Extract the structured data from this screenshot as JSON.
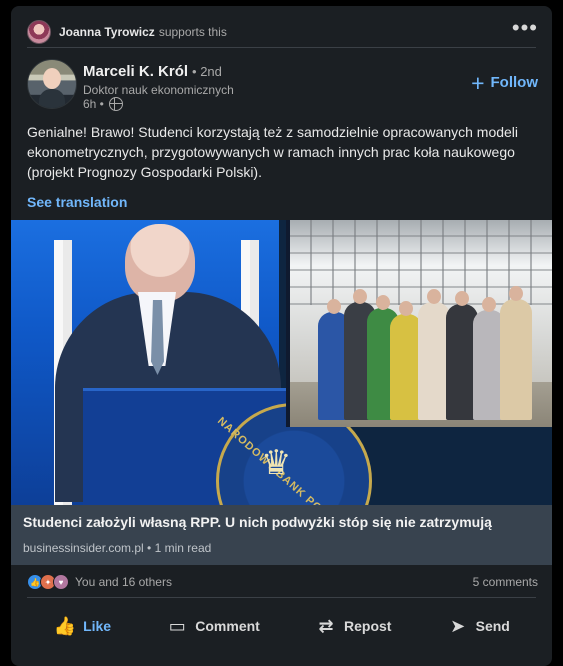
{
  "social": {
    "name": "Joanna Tyrowicz",
    "action": "supports this",
    "more_icon": "more-icon"
  },
  "author": {
    "name": "Marceli K. Król",
    "degree": "• 2nd",
    "headline": "Doktor nauk ekonomicznych",
    "time": "6h •",
    "visibility_icon": "globe-icon",
    "follow": "Follow"
  },
  "post": {
    "text": "Genialne! Brawo! Studenci korzystają też z samodzielnie opracowanych modeli ekonometrycznych, przygotowywanych w ramach innych prac koła naukowego (projekt Prognozy Gospodarki Polski).",
    "translate": "See translation"
  },
  "media": {
    "title": "Studenci założyli własną RPP. U nich podwyżki stóp się nie zatrzymują",
    "source": "businessinsider.com.pl • 1 min read",
    "seal_text": "NARODOWY BANK POLSKI"
  },
  "engagement": {
    "summary": "You and 16 others",
    "comments": "5 comments"
  },
  "actions": {
    "like": "Like",
    "comment": "Comment",
    "repost": "Repost",
    "send": "Send"
  },
  "colors": {
    "accent": "#71b7fb",
    "card": "#1b1f23",
    "caption_bg": "#38434f"
  }
}
